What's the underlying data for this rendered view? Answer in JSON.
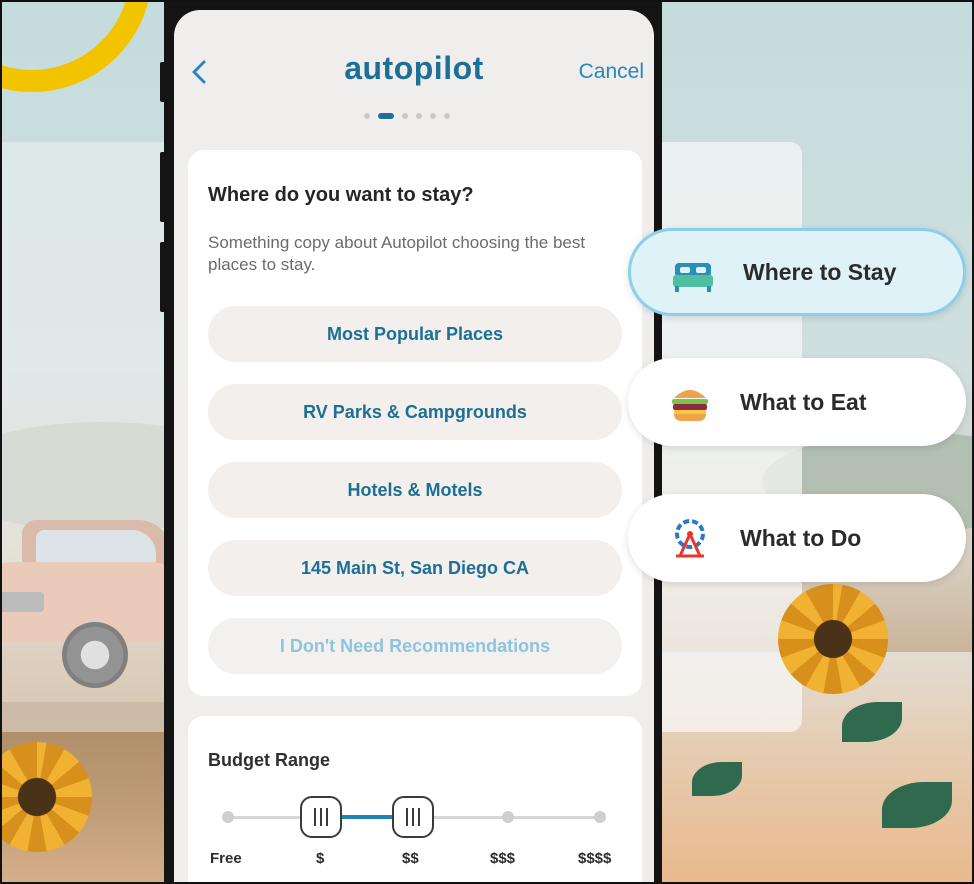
{
  "app": {
    "logo_text": "autopilot",
    "cancel_label": "Cancel",
    "step_count": 6,
    "active_step": 2
  },
  "stay_card": {
    "title": "Where do you want to stay?",
    "description": "Something copy about Autopilot choosing the best places to stay.",
    "options": [
      {
        "label": "Most Popular Places",
        "enabled": true
      },
      {
        "label": "RV Parks & Campgrounds",
        "enabled": true
      },
      {
        "label": "Hotels & Motels",
        "enabled": true
      },
      {
        "label": "145 Main St, San Diego CA",
        "enabled": true
      },
      {
        "label": "I Don't Need Recommendations",
        "enabled": false
      }
    ]
  },
  "budget": {
    "title": "Budget Range",
    "levels": [
      "Free",
      "$",
      "$$",
      "$$$",
      "$$$$"
    ],
    "selected_min": "$",
    "selected_max": "$$"
  },
  "categories": [
    {
      "label": "Where to Stay",
      "icon": "bed-icon",
      "active": true
    },
    {
      "label": "What to Eat",
      "icon": "burger-icon",
      "active": false
    },
    {
      "label": "What to Do",
      "icon": "ferris-wheel-icon",
      "active": false
    }
  ],
  "colors": {
    "brand_blue": "#1c6f95",
    "link_blue": "#2a86b8",
    "active_chip_bg": "#dff2f8",
    "active_chip_border": "#8ad0e8"
  }
}
